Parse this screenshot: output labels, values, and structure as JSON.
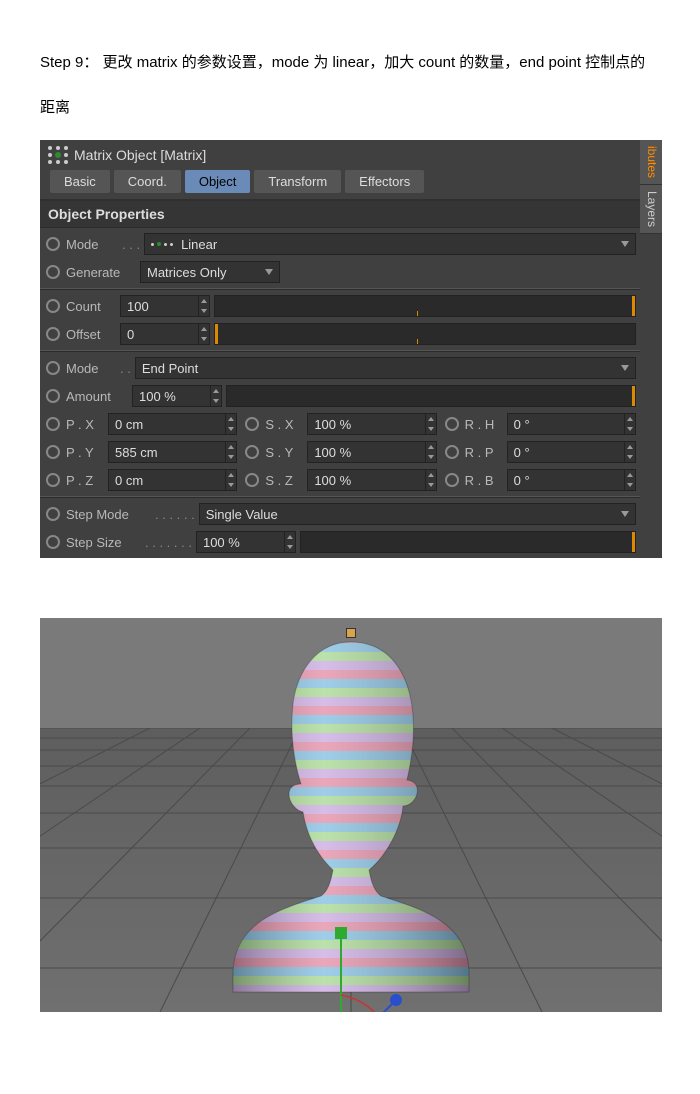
{
  "instruction": "Step 9： 更改 matrix 的参数设置，mode 为 linear，加大 count 的数量，end point 控制点的距离",
  "panel": {
    "title": "Matrix Object [Matrix]",
    "tabs": [
      "Basic",
      "Coord.",
      "Object",
      "Transform",
      "Effectors"
    ],
    "active_tab": "Object",
    "section": "Object Properties",
    "mode_label": "Mode",
    "mode_value": "Linear",
    "generate_label": "Generate",
    "generate_value": "Matrices Only",
    "count_label": "Count",
    "count_value": "100",
    "offset_label": "Offset",
    "offset_value": "0",
    "mode2_label": "Mode",
    "mode2_value": "End Point",
    "amount_label": "Amount",
    "amount_value": "100 %",
    "px_label": "P . X",
    "px_value": "0 cm",
    "py_label": "P . Y",
    "py_value": "585 cm",
    "pz_label": "P . Z",
    "pz_value": "0 cm",
    "sx_label": "S . X",
    "sx_value": "100 %",
    "sy_label": "S . Y",
    "sy_value": "100 %",
    "sz_label": "S . Z",
    "sz_value": "100 %",
    "rh_label": "R . H",
    "rh_value": "0 °",
    "rp_label": "R . P",
    "rp_value": "0 °",
    "rb_label": "R . B",
    "rb_value": "0 °",
    "stepmode_label": "Step Mode",
    "stepmode_value": "Single Value",
    "stepsize_label": "Step Size",
    "stepsize_value": "100 %"
  },
  "sidebar": {
    "attributes": "ibutes",
    "layers": "Layers"
  }
}
